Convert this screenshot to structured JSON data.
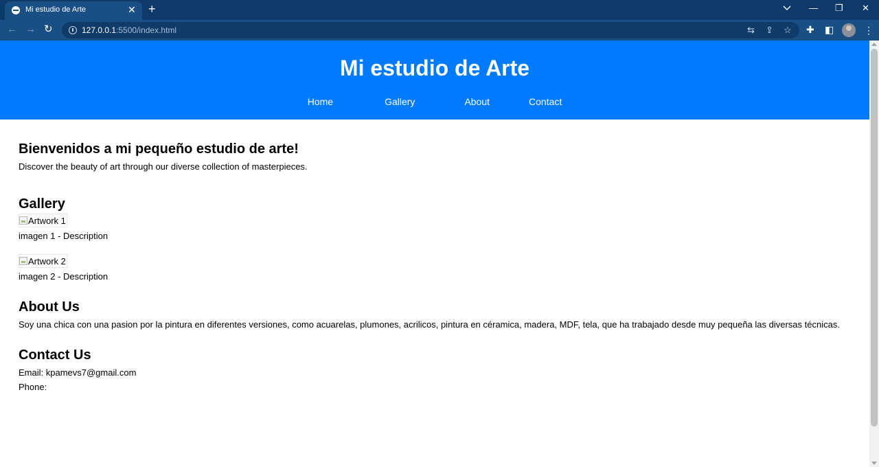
{
  "browser": {
    "tab_title": "Mi estudio de Arte",
    "url_host": "127.0.0.1",
    "url_rest": ":5500/index.html"
  },
  "site": {
    "title": "Mi estudio de Arte",
    "nav": [
      "Home",
      "Gallery",
      "About",
      "Contact"
    ],
    "accent_color": "#007bff"
  },
  "hero": {
    "heading": "Bienvenidos a mi pequeño estudio de arte!",
    "text": "Discover the beauty of art through our diverse collection of masterpieces."
  },
  "gallery": {
    "heading": "Gallery",
    "items": [
      {
        "alt": "Artwork 1",
        "caption": "imagen 1 - Description"
      },
      {
        "alt": "Artwork 2",
        "caption": "imagen 2 - Description"
      }
    ]
  },
  "about": {
    "heading": "About Us",
    "text": "Soy una chica con una pasion por la pintura en diferentes versiones, como acuarelas, plumones, acrilicos, pintura en céramica, madera, MDF, tela, que ha trabajado desde muy pequeña las diversas técnicas."
  },
  "contact": {
    "heading": "Contact Us",
    "email": "Email: kpamevs7@gmail.com",
    "phone": "Phone:"
  }
}
